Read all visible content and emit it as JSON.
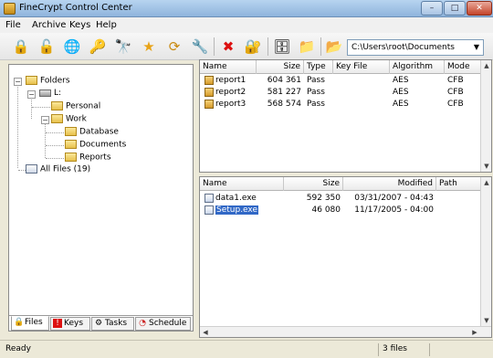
{
  "window": {
    "title": "FineCrypt Control Center"
  },
  "window_controls": {
    "minimize": "–",
    "maximize": "□",
    "close": "✕"
  },
  "menu": [
    "File",
    "Archive",
    "Keys",
    "Help"
  ],
  "toolbar": {
    "buttons": [
      {
        "name": "encrypt-button",
        "icon": "lock-icon",
        "glyph": "🔒"
      },
      {
        "name": "decrypt-button",
        "icon": "unlock-icon",
        "glyph": "🔓"
      },
      {
        "name": "globe-button",
        "icon": "globe-icon",
        "glyph": "🌐"
      },
      {
        "name": "key-button",
        "icon": "key-icon",
        "glyph": "🔑"
      },
      {
        "name": "search-key-button",
        "icon": "binoculars-icon",
        "glyph": "🔭"
      },
      {
        "name": "favorite-button",
        "icon": "star-icon",
        "glyph": "★"
      },
      {
        "name": "refresh-button",
        "icon": "refresh-icon",
        "glyph": "⟳"
      },
      {
        "name": "settings-button",
        "icon": "wrench-icon",
        "glyph": "🔧"
      },
      {
        "name": "delete-button",
        "icon": "delete-icon",
        "glyph": "✖"
      },
      {
        "name": "lock-file-button",
        "icon": "lock-file-icon",
        "glyph": "🔐"
      },
      {
        "name": "archive-button",
        "icon": "archive-icon",
        "glyph": "🗄"
      },
      {
        "name": "extract-button",
        "icon": "folder-arrow-icon",
        "glyph": "📁"
      },
      {
        "name": "browse-folder-button",
        "icon": "folder-icon",
        "glyph": "📂"
      }
    ],
    "path": "C:\\Users\\root\\Documents"
  },
  "tree": {
    "root": "Folders",
    "drive": "L:",
    "personal": "Personal",
    "work": "Work",
    "database": "Database",
    "documents": "Documents",
    "reports": "Reports",
    "all_files": "All Files (19)",
    "collapse_glyph": "−"
  },
  "left_tabs": [
    {
      "label": "Files",
      "glyph": "🔒"
    },
    {
      "label": "Keys",
      "glyph": "!"
    },
    {
      "label": "Tasks",
      "glyph": "⚙"
    },
    {
      "label": "Schedule",
      "glyph": "◔"
    }
  ],
  "archive_table": {
    "columns": [
      "Name",
      "Size",
      "Type",
      "Key File",
      "Algorithm",
      "Mode"
    ],
    "rows": [
      {
        "name": "report1",
        "size": "604 361",
        "type": "Pass",
        "key_file": "",
        "algorithm": "AES",
        "mode": "CFB"
      },
      {
        "name": "report2",
        "size": "581 227",
        "type": "Pass",
        "key_file": "",
        "algorithm": "AES",
        "mode": "CFB"
      },
      {
        "name": "report3",
        "size": "568 574",
        "type": "Pass",
        "key_file": "",
        "algorithm": "AES",
        "mode": "CFB"
      }
    ]
  },
  "files_table": {
    "columns": [
      "Name",
      "Size",
      "Modified",
      "Path"
    ],
    "rows": [
      {
        "name": "data1.exe",
        "size": "592 350",
        "modified": "03/31/2007 - 04:43",
        "path": ""
      },
      {
        "name": "Setup.exe",
        "size": "46 080",
        "modified": "11/17/2005 - 04:00",
        "path": ""
      }
    ]
  },
  "scroll_glyphs": {
    "up": "▲",
    "down": "▼",
    "left": "◀",
    "right": "▶",
    "dropdown": "▼"
  },
  "status": {
    "left": "Ready",
    "count": "3 files"
  },
  "colors": {
    "selection": "#3168c6",
    "titlebar": "#8fb4dc"
  }
}
